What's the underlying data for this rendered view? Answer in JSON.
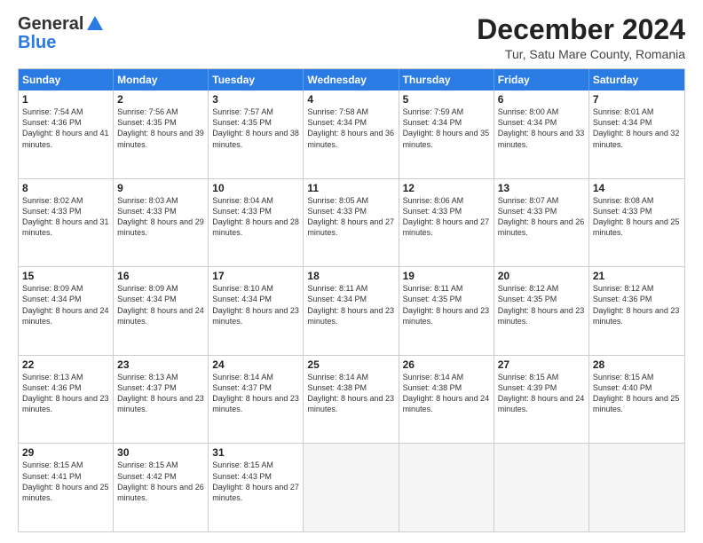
{
  "logo": {
    "line1": "General",
    "line2": "Blue"
  },
  "header": {
    "title": "December 2024",
    "subtitle": "Tur, Satu Mare County, Romania"
  },
  "calendar": {
    "weekdays": [
      "Sunday",
      "Monday",
      "Tuesday",
      "Wednesday",
      "Thursday",
      "Friday",
      "Saturday"
    ],
    "rows": [
      [
        {
          "day": "1",
          "info": "Sunrise: 7:54 AM\nSunset: 4:36 PM\nDaylight: 8 hours and 41 minutes."
        },
        {
          "day": "2",
          "info": "Sunrise: 7:56 AM\nSunset: 4:35 PM\nDaylight: 8 hours and 39 minutes."
        },
        {
          "day": "3",
          "info": "Sunrise: 7:57 AM\nSunset: 4:35 PM\nDaylight: 8 hours and 38 minutes."
        },
        {
          "day": "4",
          "info": "Sunrise: 7:58 AM\nSunset: 4:34 PM\nDaylight: 8 hours and 36 minutes."
        },
        {
          "day": "5",
          "info": "Sunrise: 7:59 AM\nSunset: 4:34 PM\nDaylight: 8 hours and 35 minutes."
        },
        {
          "day": "6",
          "info": "Sunrise: 8:00 AM\nSunset: 4:34 PM\nDaylight: 8 hours and 33 minutes."
        },
        {
          "day": "7",
          "info": "Sunrise: 8:01 AM\nSunset: 4:34 PM\nDaylight: 8 hours and 32 minutes."
        }
      ],
      [
        {
          "day": "8",
          "info": "Sunrise: 8:02 AM\nSunset: 4:33 PM\nDaylight: 8 hours and 31 minutes."
        },
        {
          "day": "9",
          "info": "Sunrise: 8:03 AM\nSunset: 4:33 PM\nDaylight: 8 hours and 29 minutes."
        },
        {
          "day": "10",
          "info": "Sunrise: 8:04 AM\nSunset: 4:33 PM\nDaylight: 8 hours and 28 minutes."
        },
        {
          "day": "11",
          "info": "Sunrise: 8:05 AM\nSunset: 4:33 PM\nDaylight: 8 hours and 27 minutes."
        },
        {
          "day": "12",
          "info": "Sunrise: 8:06 AM\nSunset: 4:33 PM\nDaylight: 8 hours and 27 minutes."
        },
        {
          "day": "13",
          "info": "Sunrise: 8:07 AM\nSunset: 4:33 PM\nDaylight: 8 hours and 26 minutes."
        },
        {
          "day": "14",
          "info": "Sunrise: 8:08 AM\nSunset: 4:33 PM\nDaylight: 8 hours and 25 minutes."
        }
      ],
      [
        {
          "day": "15",
          "info": "Sunrise: 8:09 AM\nSunset: 4:34 PM\nDaylight: 8 hours and 24 minutes."
        },
        {
          "day": "16",
          "info": "Sunrise: 8:09 AM\nSunset: 4:34 PM\nDaylight: 8 hours and 24 minutes."
        },
        {
          "day": "17",
          "info": "Sunrise: 8:10 AM\nSunset: 4:34 PM\nDaylight: 8 hours and 23 minutes."
        },
        {
          "day": "18",
          "info": "Sunrise: 8:11 AM\nSunset: 4:34 PM\nDaylight: 8 hours and 23 minutes."
        },
        {
          "day": "19",
          "info": "Sunrise: 8:11 AM\nSunset: 4:35 PM\nDaylight: 8 hours and 23 minutes."
        },
        {
          "day": "20",
          "info": "Sunrise: 8:12 AM\nSunset: 4:35 PM\nDaylight: 8 hours and 23 minutes."
        },
        {
          "day": "21",
          "info": "Sunrise: 8:12 AM\nSunset: 4:36 PM\nDaylight: 8 hours and 23 minutes."
        }
      ],
      [
        {
          "day": "22",
          "info": "Sunrise: 8:13 AM\nSunset: 4:36 PM\nDaylight: 8 hours and 23 minutes."
        },
        {
          "day": "23",
          "info": "Sunrise: 8:13 AM\nSunset: 4:37 PM\nDaylight: 8 hours and 23 minutes."
        },
        {
          "day": "24",
          "info": "Sunrise: 8:14 AM\nSunset: 4:37 PM\nDaylight: 8 hours and 23 minutes."
        },
        {
          "day": "25",
          "info": "Sunrise: 8:14 AM\nSunset: 4:38 PM\nDaylight: 8 hours and 23 minutes."
        },
        {
          "day": "26",
          "info": "Sunrise: 8:14 AM\nSunset: 4:38 PM\nDaylight: 8 hours and 24 minutes."
        },
        {
          "day": "27",
          "info": "Sunrise: 8:15 AM\nSunset: 4:39 PM\nDaylight: 8 hours and 24 minutes."
        },
        {
          "day": "28",
          "info": "Sunrise: 8:15 AM\nSunset: 4:40 PM\nDaylight: 8 hours and 25 minutes."
        }
      ],
      [
        {
          "day": "29",
          "info": "Sunrise: 8:15 AM\nSunset: 4:41 PM\nDaylight: 8 hours and 25 minutes."
        },
        {
          "day": "30",
          "info": "Sunrise: 8:15 AM\nSunset: 4:42 PM\nDaylight: 8 hours and 26 minutes."
        },
        {
          "day": "31",
          "info": "Sunrise: 8:15 AM\nSunset: 4:43 PM\nDaylight: 8 hours and 27 minutes."
        },
        {
          "day": "",
          "info": ""
        },
        {
          "day": "",
          "info": ""
        },
        {
          "day": "",
          "info": ""
        },
        {
          "day": "",
          "info": ""
        }
      ]
    ]
  }
}
